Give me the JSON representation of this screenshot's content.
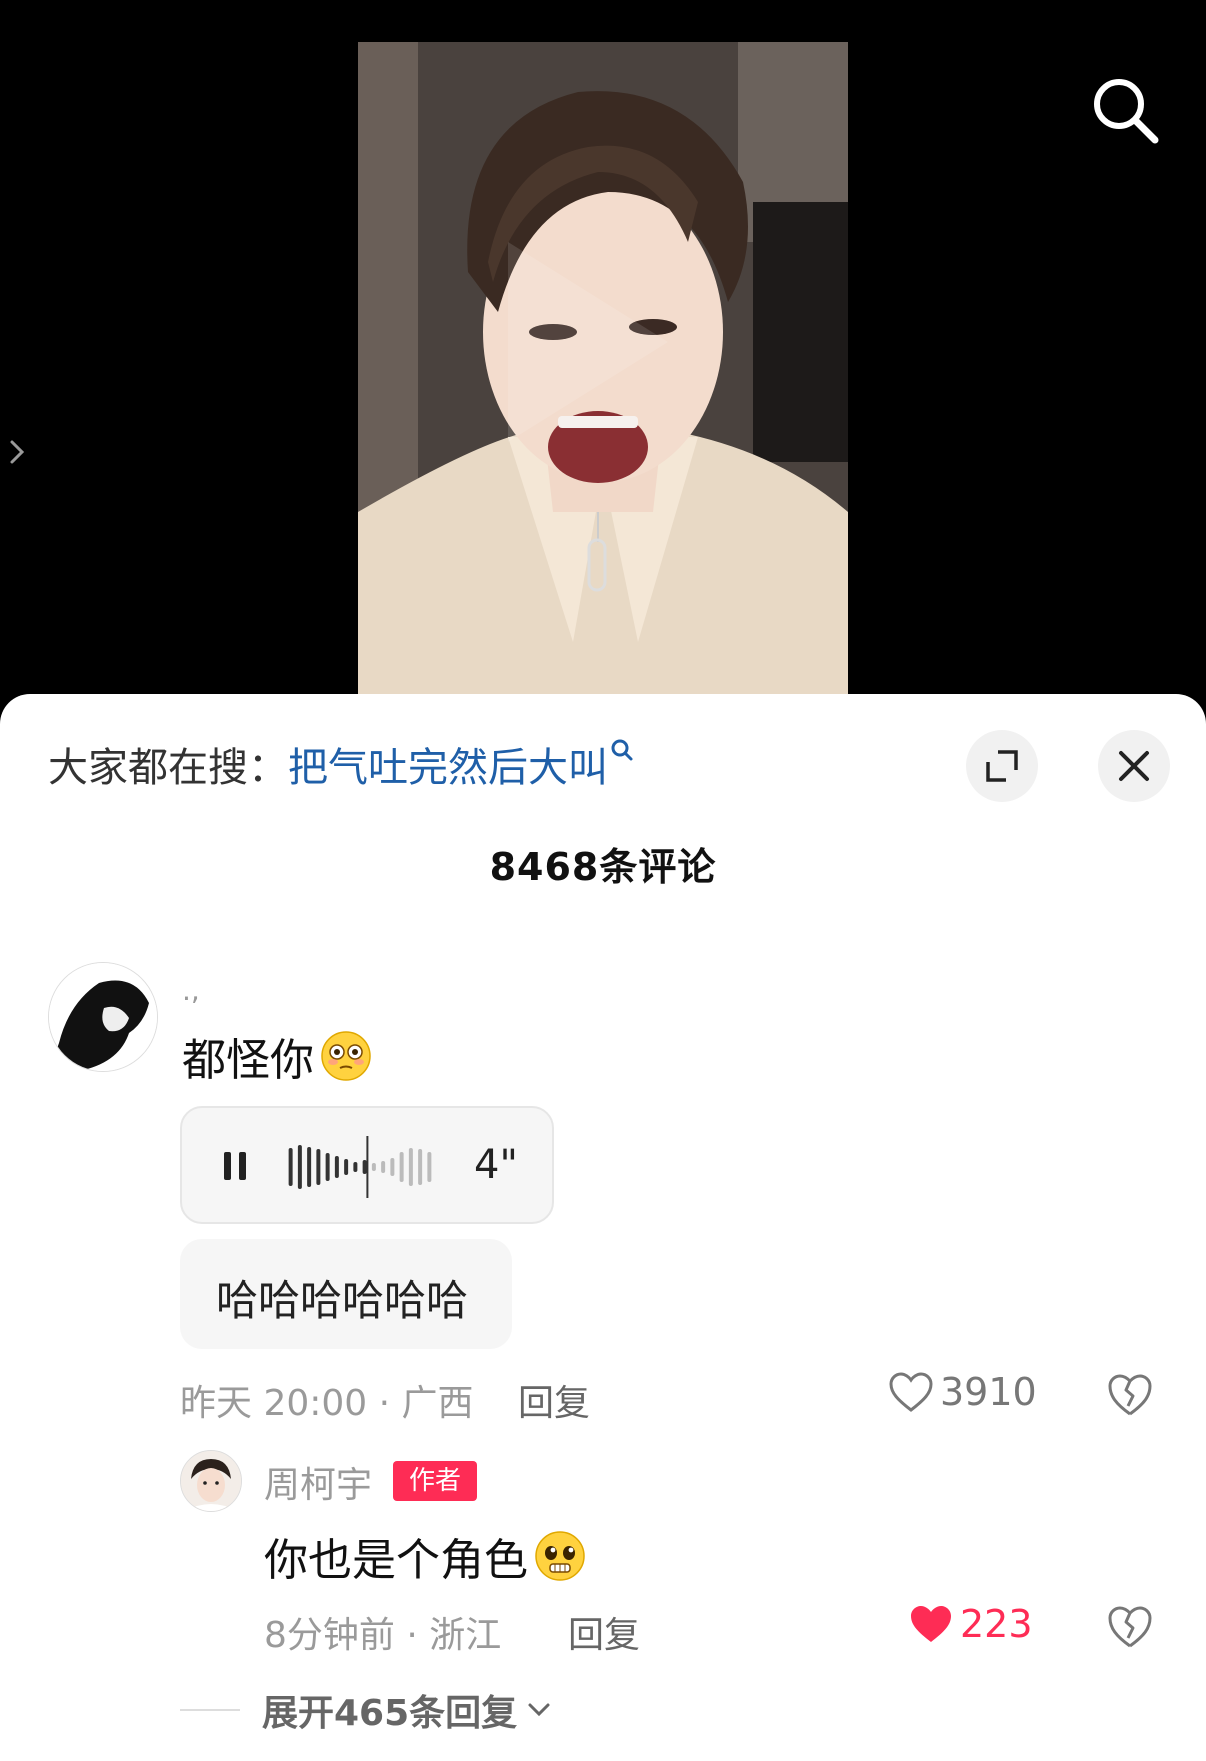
{
  "video": {
    "search_icon": "search-icon",
    "side_icon": "chevron-right-icon"
  },
  "sheet": {
    "trending": {
      "prefix": "大家都在搜：",
      "term": "把气吐完然后大叫",
      "icon": "search-icon"
    },
    "expand_icon": "expand-icon",
    "close_icon": "close-icon",
    "comment_count": "8468条评论"
  },
  "comment": {
    "username": ".,",
    "text": "都怪你",
    "emoji": "flushed-face",
    "voice": {
      "duration": "4\"",
      "icon": "pause-icon",
      "progress": 0.55
    },
    "transcript": "哈哈哈哈哈哈",
    "meta": "昨天 20:00 · 广西",
    "reply_label": "回复",
    "likes": "3910",
    "liked": false
  },
  "reply": {
    "username": "周柯宇",
    "badge": "作者",
    "text": "你也是个角色",
    "emoji": "pleading-face",
    "meta": "8分钟前 · 浙江",
    "reply_label": "回复",
    "likes": "223",
    "liked": true
  },
  "expand_replies": "展开465条回复",
  "colors": {
    "accent": "#fe2c55",
    "link": "#1f5fa8",
    "muted": "#9a9a9a"
  }
}
